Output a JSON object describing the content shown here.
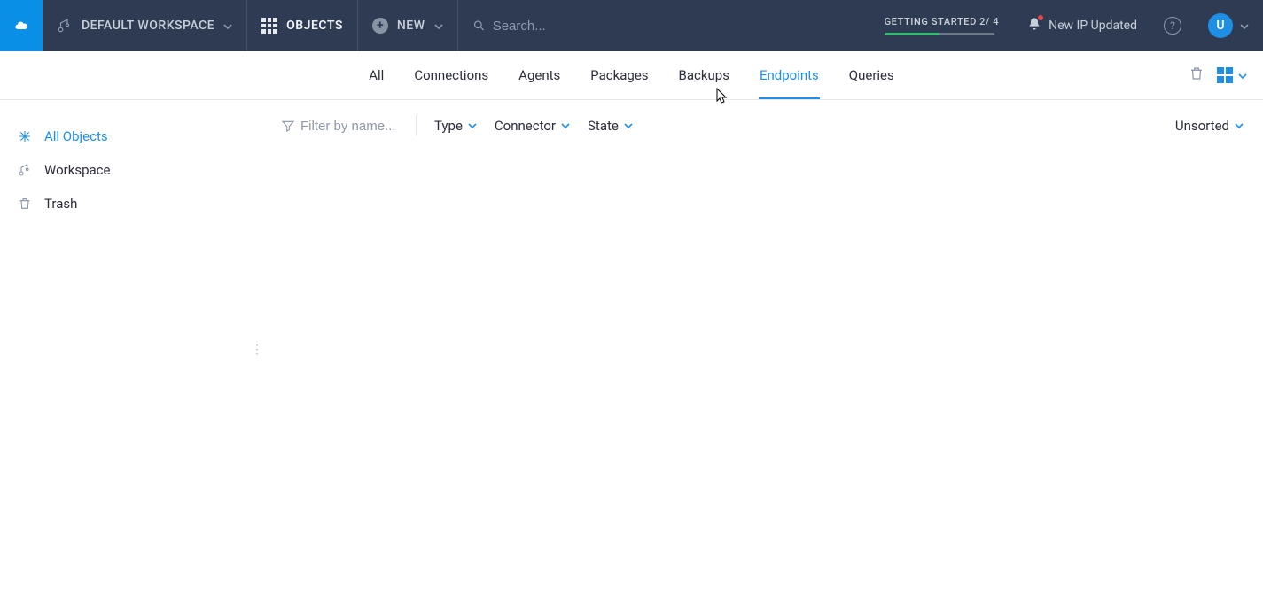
{
  "topbar": {
    "workspace_label": "DEFAULT WORKSPACE",
    "objects_label": "OBJECTS",
    "new_label": "NEW",
    "search_placeholder": "Search...",
    "getting_started_label": "GETTING STARTED 2/ 4",
    "getting_started_progress_pct": 50,
    "notification_text": "New IP Updated",
    "help_glyph": "?",
    "avatar_letter": "U"
  },
  "tabs": [
    {
      "label": "All"
    },
    {
      "label": "Connections"
    },
    {
      "label": "Agents"
    },
    {
      "label": "Packages"
    },
    {
      "label": "Backups"
    },
    {
      "label": "Endpoints",
      "active": true
    },
    {
      "label": "Queries"
    }
  ],
  "sidebar": {
    "items": [
      {
        "label": "All Objects",
        "active": true
      },
      {
        "label": "Workspace"
      },
      {
        "label": "Trash"
      }
    ]
  },
  "filters": {
    "name_placeholder": "Filter by name...",
    "dropdowns": [
      {
        "label": "Type"
      },
      {
        "label": "Connector"
      },
      {
        "label": "State"
      }
    ],
    "sort_label": "Unsorted"
  }
}
